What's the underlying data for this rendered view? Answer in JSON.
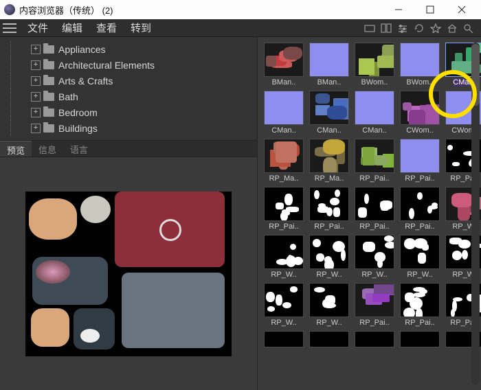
{
  "window": {
    "title": "内容浏览器（传统）  (2)"
  },
  "menus": {
    "file": "文件",
    "edit": "编辑",
    "view": "查看",
    "goto": "转到"
  },
  "tree": {
    "items": [
      {
        "label": "Appliances"
      },
      {
        "label": "Architectural Elements"
      },
      {
        "label": "Arts & Crafts"
      },
      {
        "label": "Bath"
      },
      {
        "label": "Bedroom"
      },
      {
        "label": "Buildings"
      }
    ]
  },
  "tabs": {
    "preview": "预览",
    "info": "信息",
    "lang": "语言"
  },
  "thumbs": {
    "items": [
      {
        "label": "BMan..",
        "bg": "tex1"
      },
      {
        "label": "BMan..",
        "bg": "purple"
      },
      {
        "label": "BWom..",
        "bg": "tex2"
      },
      {
        "label": "BWom..",
        "bg": "purple"
      },
      {
        "label": "CMan..",
        "bg": "tex3",
        "selected": true
      },
      {
        "label": "CMan..",
        "bg": "purple"
      },
      {
        "label": "CMan..",
        "bg": "tex4"
      },
      {
        "label": "CMan..",
        "bg": "purple"
      },
      {
        "label": "CWom..",
        "bg": "tex5"
      },
      {
        "label": "CWom..",
        "bg": "purple"
      },
      {
        "label": "RP_Ma..",
        "bg": "tex6"
      },
      {
        "label": "RP_Ma..",
        "bg": "tex7"
      },
      {
        "label": "RP_Pai..",
        "bg": "tex8"
      },
      {
        "label": "RP_Pai..",
        "bg": "purple"
      },
      {
        "label": "RP_Pai..",
        "bg": "mask1"
      },
      {
        "label": "RP_Pai..",
        "bg": "mask2"
      },
      {
        "label": "RP_Pai..",
        "bg": "mask3"
      },
      {
        "label": "RP_Pai..",
        "bg": "mask4"
      },
      {
        "label": "RP_Pai..",
        "bg": "mask5"
      },
      {
        "label": "RP_W..",
        "bg": "tex9"
      },
      {
        "label": "RP_W..",
        "bg": "mask6"
      },
      {
        "label": "RP_W..",
        "bg": "mask7"
      },
      {
        "label": "RP_W..",
        "bg": "mask8"
      },
      {
        "label": "RP_W..",
        "bg": "mask9"
      },
      {
        "label": "RP_W..",
        "bg": "mask10"
      },
      {
        "label": "RP_W..",
        "bg": "mask11"
      },
      {
        "label": "RP_W..",
        "bg": "mask12"
      },
      {
        "label": "RP_Pai..",
        "bg": "tex10"
      },
      {
        "label": "RP_Pai..",
        "bg": "mask13"
      },
      {
        "label": "RP_Pai..",
        "bg": "mask14"
      },
      {
        "label": "",
        "bg": "blackcut"
      },
      {
        "label": "",
        "bg": "blackcut"
      },
      {
        "label": "",
        "bg": "blackcut"
      },
      {
        "label": "",
        "bg": "blackcut"
      },
      {
        "label": "",
        "bg": "blackcut"
      }
    ]
  }
}
